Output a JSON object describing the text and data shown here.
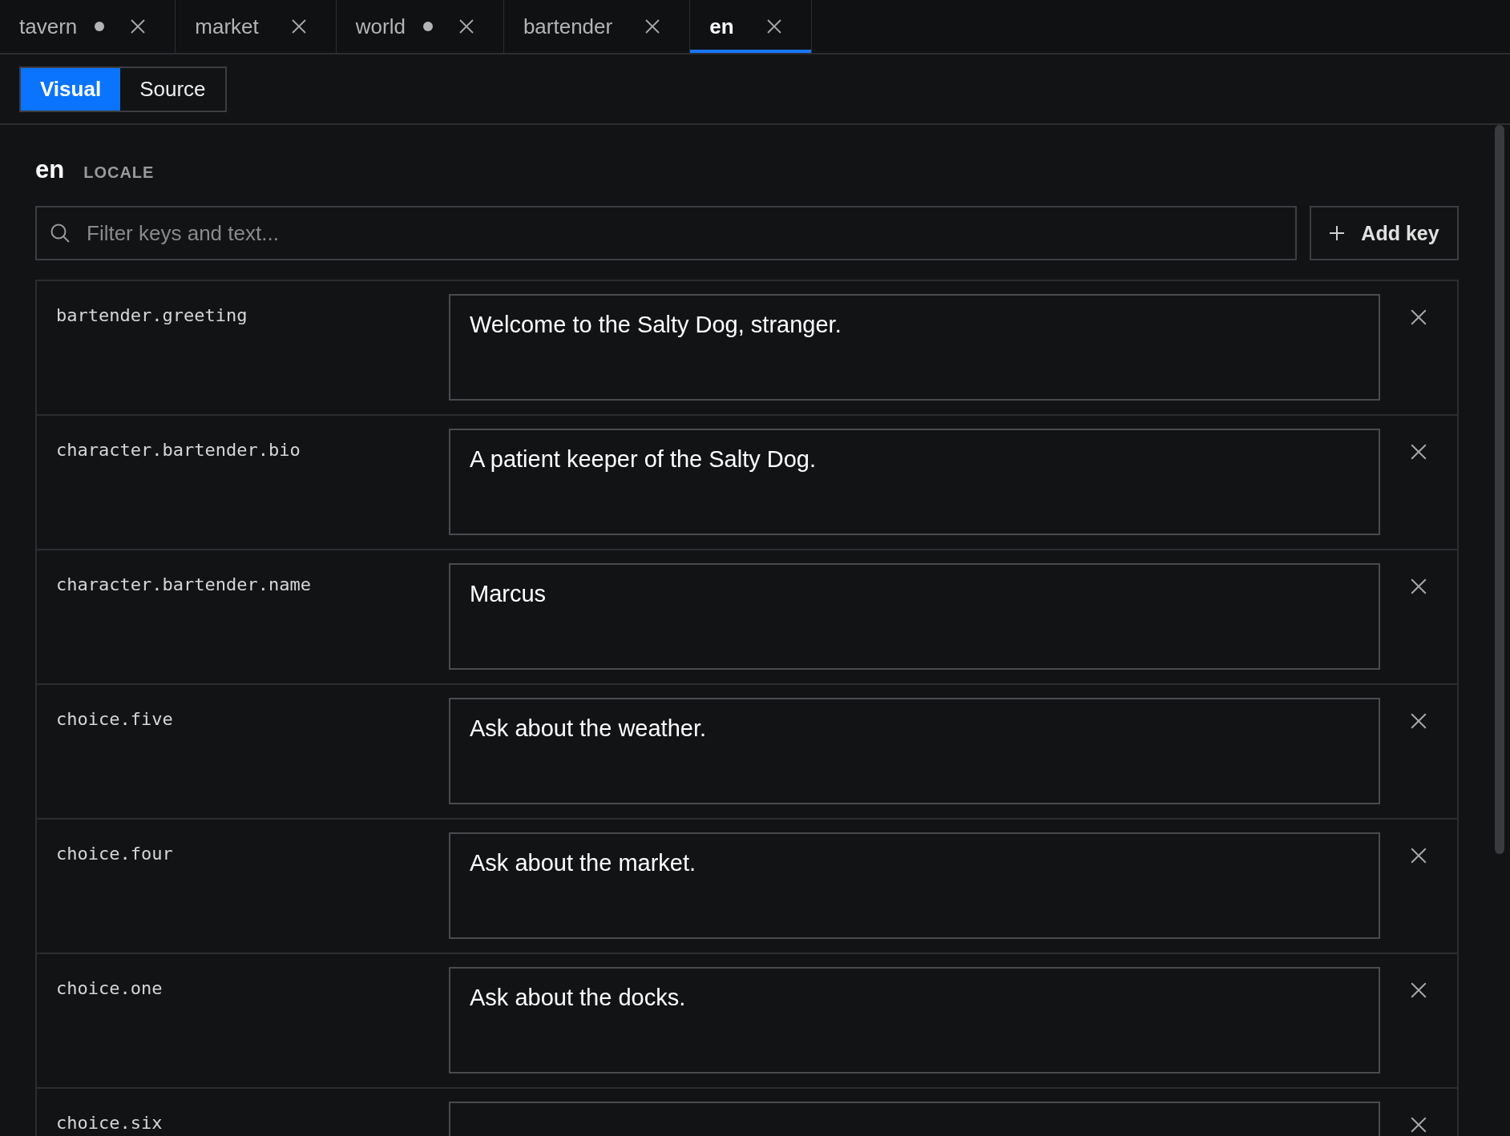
{
  "tabs": [
    {
      "label": "tavern",
      "modified": true,
      "selected": false
    },
    {
      "label": "market",
      "modified": false,
      "selected": false
    },
    {
      "label": "world",
      "modified": true,
      "selected": false
    },
    {
      "label": "bartender",
      "modified": false,
      "selected": false
    },
    {
      "label": "en",
      "modified": false,
      "selected": true
    }
  ],
  "view_toggle": [
    {
      "label": "Visual",
      "selected": true
    },
    {
      "label": "Source",
      "selected": false
    }
  ],
  "header": {
    "title": "en",
    "subtitle": "LOCALE"
  },
  "search": {
    "placeholder": "Filter keys and text..."
  },
  "add_button": {
    "label": "Add key"
  },
  "entries": [
    {
      "key": "bartender.greeting",
      "value": "Welcome to the Salty Dog, stranger."
    },
    {
      "key": "character.bartender.bio",
      "value": "A patient keeper of the Salty Dog."
    },
    {
      "key": "character.bartender.name",
      "value": "Marcus"
    },
    {
      "key": "choice.five",
      "value": "Ask about the weather."
    },
    {
      "key": "choice.four",
      "value": "Ask about the market."
    },
    {
      "key": "choice.one",
      "value": "Ask about the docks."
    },
    {
      "key": "choice.six"
    }
  ]
}
